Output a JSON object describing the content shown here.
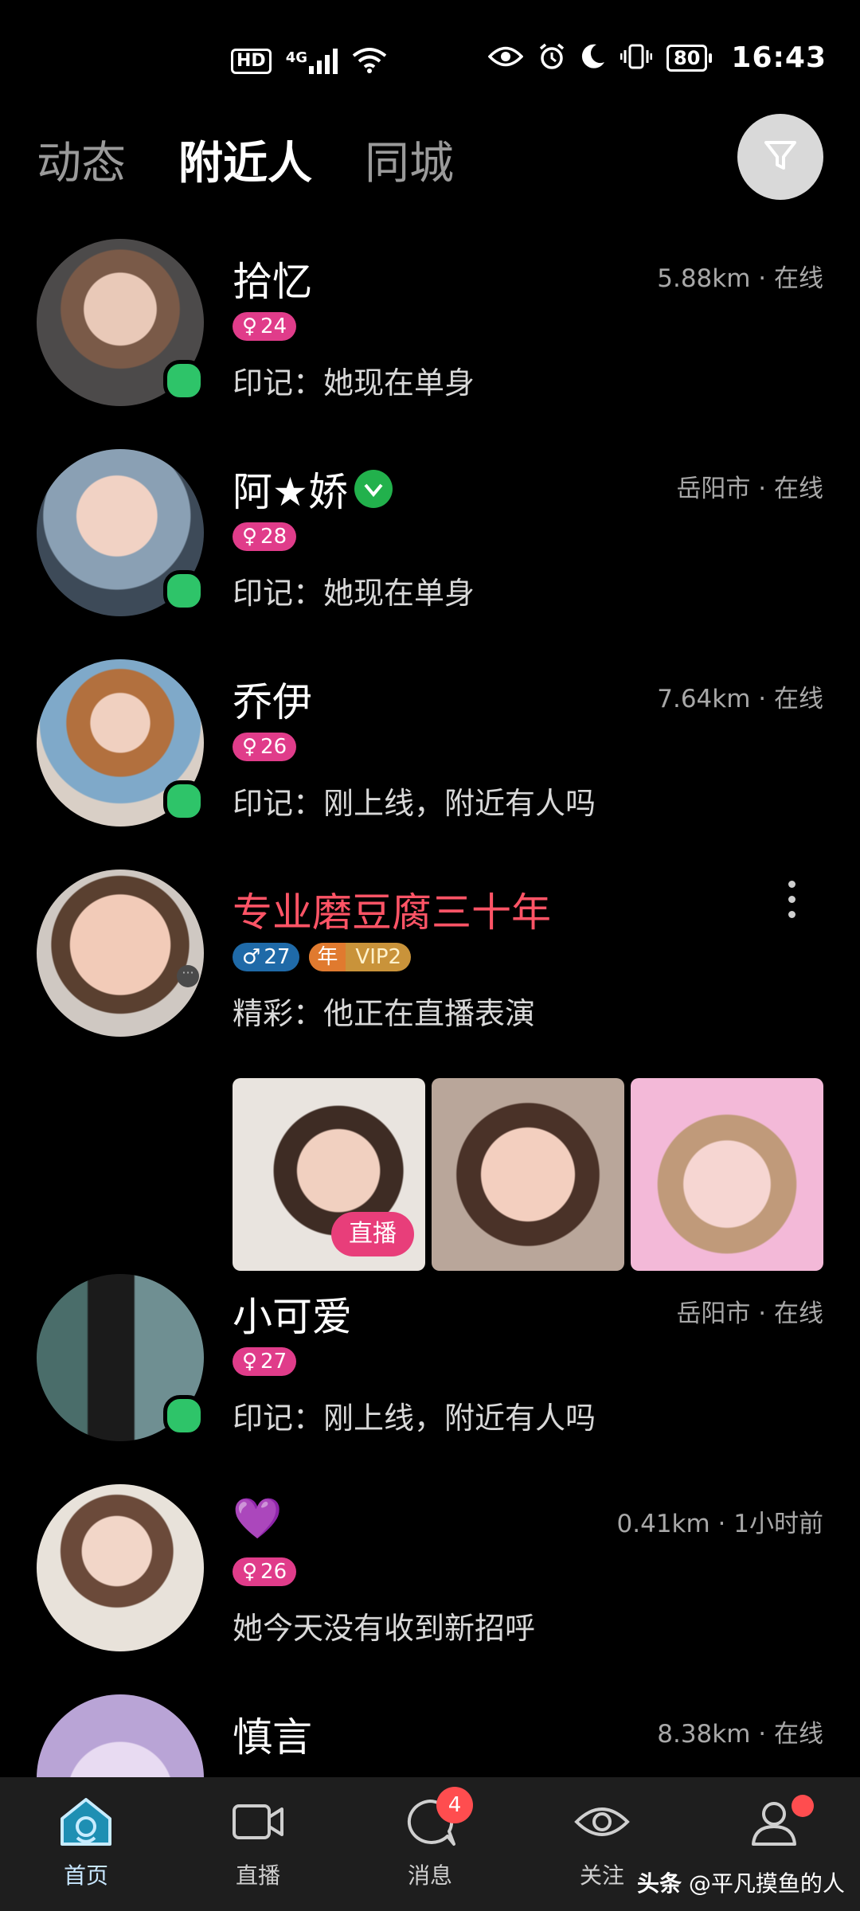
{
  "status_bar": {
    "hd": "HD",
    "network": "4G",
    "battery": "80",
    "time": "16:43"
  },
  "tabs": [
    {
      "label": "动态",
      "active": false
    },
    {
      "label": "附近人",
      "active": true
    },
    {
      "label": "同城",
      "active": false
    }
  ],
  "users": [
    {
      "name": "拾忆",
      "meta": "5.88km · 在线",
      "gender": "female",
      "age": "24",
      "sign": "印记：她现在单身",
      "online": true
    },
    {
      "name": "阿★娇",
      "meta": "岳阳市 · 在线",
      "gender": "female",
      "age": "28",
      "sign": "印记：她现在单身",
      "online": true,
      "verified": true
    },
    {
      "name": "乔伊",
      "meta": "7.64km · 在线",
      "gender": "female",
      "age": "26",
      "sign": "印记：刚上线，附近有人吗",
      "online": true
    },
    {
      "name": "专业磨豆腐三十年",
      "gender": "male",
      "age": "27",
      "year_badge": "年",
      "vip": "VIP2",
      "sign": "精彩：他正在直播表演",
      "live_label": "直播"
    },
    {
      "name": "小可爱",
      "meta": "岳阳市 · 在线",
      "gender": "female",
      "age": "27",
      "sign": "印记：刚上线，附近有人吗",
      "online": true
    },
    {
      "name": "💜",
      "meta": "0.41km · 1小时前",
      "gender": "female",
      "age": "26",
      "sign": "她今天没有收到新招呼"
    },
    {
      "name": "慎言",
      "meta": "8.38km · 在线"
    }
  ],
  "bottom_nav": [
    {
      "label": "首页",
      "icon": "home-icon",
      "active": true
    },
    {
      "label": "直播",
      "icon": "video-icon"
    },
    {
      "label": "消息",
      "icon": "message-icon",
      "badge": "4"
    },
    {
      "label": "关注",
      "icon": "eye-icon"
    },
    {
      "label": "",
      "icon": "profile-icon",
      "dot": true
    }
  ],
  "watermark": {
    "brand": "头条",
    "handle": "@平凡摸鱼的人"
  },
  "colors": {
    "accent_red": "#ff5466",
    "online_green": "#2ec469",
    "female_pink": "#e03c8a",
    "male_blue": "#1f6aa8"
  }
}
